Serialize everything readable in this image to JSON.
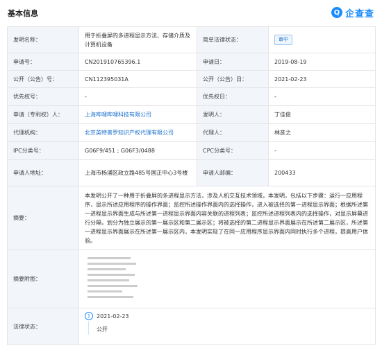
{
  "header": {
    "title": "基本信息",
    "brand_icon": "Q",
    "brand_name": "企查查"
  },
  "rows": {
    "invention_name": {
      "label": "发明名称：",
      "value": "用于折叠屏的多进程显示方法、存储介质及计算机设备"
    },
    "legal_status_brief": {
      "label": "简单法律状态：",
      "badge": "审中"
    },
    "app_no": {
      "label": "申请号：",
      "value": "CN201910765396.1"
    },
    "app_date": {
      "label": "申请日：",
      "value": "2019-08-19"
    },
    "pub_no": {
      "label": "公开（公告）号：",
      "value": "CN112395031A"
    },
    "pub_date": {
      "label": "公开（公告）日：",
      "value": "2021-02-23"
    },
    "priority_no": {
      "label": "优先权号：",
      "value": "-"
    },
    "priority_date": {
      "label": "优先权日：",
      "value": "-"
    },
    "applicant": {
      "label": "申请（专利权）人：",
      "value": "上海哔哩哔哩科技有限公司"
    },
    "inventor": {
      "label": "发明人：",
      "value": "丁佳俊"
    },
    "agency": {
      "label": "代理机构：",
      "value": "北京英特普罗知识产权代理有限公司"
    },
    "agent": {
      "label": "代理人：",
      "value": "林彦之"
    },
    "ipc": {
      "label": "IPC分类号：",
      "value": "G06F9/451 ;  G06F3/0488"
    },
    "cpc": {
      "label": "CPC分类号：",
      "value": "-"
    },
    "address": {
      "label": "申请人地址：",
      "value": "上海市杨浦区政立路485号国正中心3号楼"
    },
    "postcode": {
      "label": "申请人邮编：",
      "value": "200433"
    },
    "abstract": {
      "label": "摘要：",
      "value": "本发明公开了一种用于折叠屏的多进程显示方法，涉及人机交互技术领域，本发明，包括以下步骤：运行一应用程序，显示所述应用程序的操作界面；监控所述操作界面内的选择操作，进入被选择的第一进程显示界面；根据所述第一进程显示界面生成与所述第一进程显示界面内容关联的进程列表；监控所述进程列表内的选择操作，对显示屏幕进行分隔，划分为独立展示的第一展示区和第二展示区；将被选择的第二进程显示界面展示在所述第二展示区，所述第一进程显示界面展示在所述第一展示区内，本发明实现了在同一应用程序显示界面内同时执行多个进程，提高用户体验。"
    },
    "figure": {
      "label": "摘要附图："
    },
    "legal": {
      "label": "法律状态：",
      "step": "1",
      "date": "2021-02-23",
      "status": "公开"
    }
  }
}
